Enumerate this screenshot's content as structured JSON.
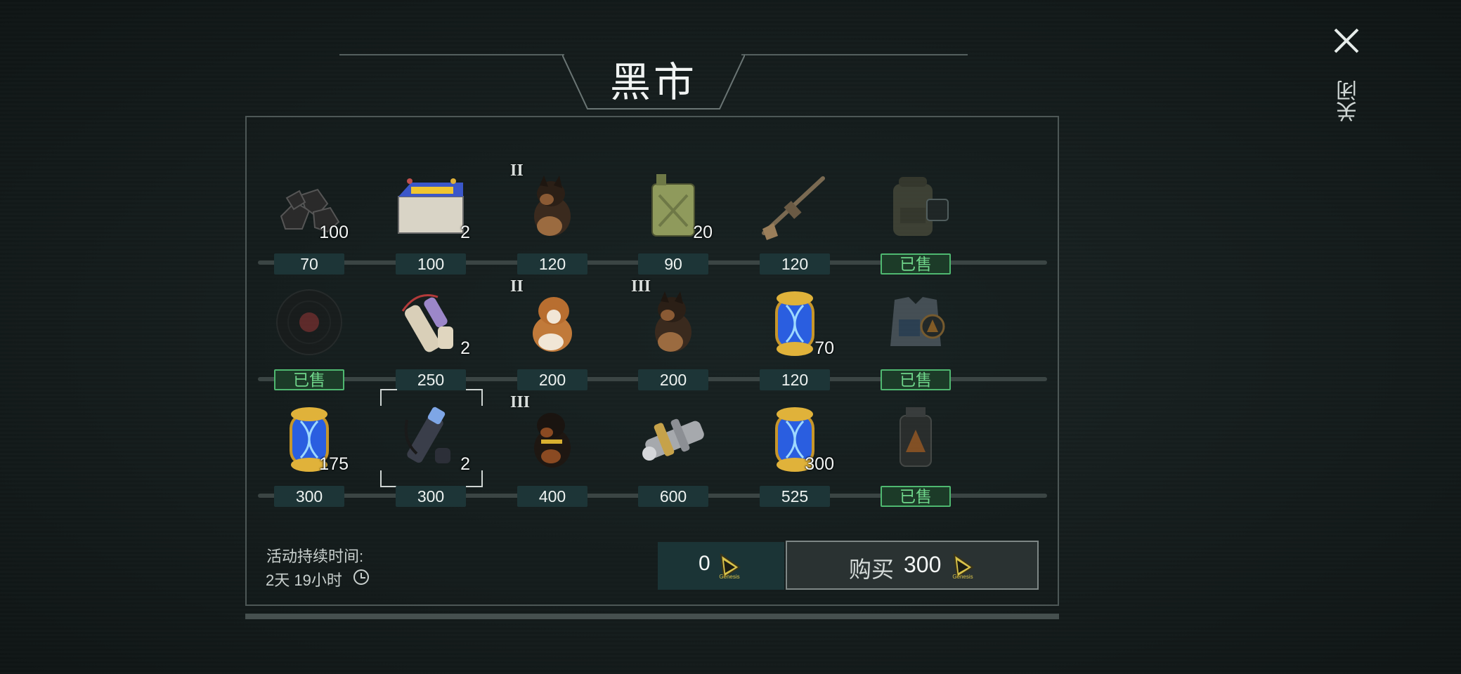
{
  "title": "黑市",
  "close_label": "关闭",
  "items": [
    {
      "icon": "coal-icon",
      "qty": "100",
      "tier": "",
      "price": "70",
      "sold": false
    },
    {
      "icon": "battery-icon",
      "qty": "2",
      "tier": "",
      "price": "100",
      "sold": false
    },
    {
      "icon": "puppy-shepherd-icon",
      "qty": "",
      "tier": "II",
      "price": "120",
      "sold": false
    },
    {
      "icon": "fuel-can-icon",
      "qty": "20",
      "tier": "",
      "price": "90",
      "sold": false
    },
    {
      "icon": "rifle-icon",
      "qty": "",
      "tier": "",
      "price": "120",
      "sold": false
    },
    {
      "icon": "backpack-icon",
      "qty": "",
      "tier": "",
      "price": "已售",
      "sold": true
    },
    {
      "icon": "vinyl-record-icon",
      "qty": "",
      "tier": "",
      "price": "已售",
      "sold": true
    },
    {
      "icon": "scroll-tube-icon",
      "qty": "2",
      "tier": "",
      "price": "250",
      "sold": false
    },
    {
      "icon": "puppy-saint-bernard-icon",
      "qty": "",
      "tier": "II",
      "price": "200",
      "sold": false
    },
    {
      "icon": "puppy-shepherd-icon",
      "qty": "",
      "tier": "III",
      "price": "200",
      "sold": false
    },
    {
      "icon": "dna-capsule-icon",
      "qty": "70",
      "tier": "",
      "price": "120",
      "sold": false
    },
    {
      "icon": "body-armor-icon",
      "qty": "",
      "tier": "",
      "price": "已售",
      "sold": true
    },
    {
      "icon": "dna-capsule-icon",
      "qty": "175",
      "tier": "",
      "price": "300",
      "sold": false
    },
    {
      "icon": "scope-parts-icon",
      "qty": "2",
      "tier": "",
      "price": "300",
      "sold": false,
      "selected": true
    },
    {
      "icon": "puppy-rottweiler-icon",
      "qty": "",
      "tier": "III",
      "price": "400",
      "sold": false
    },
    {
      "icon": "gear-shaft-icon",
      "qty": "",
      "tier": "",
      "price": "600",
      "sold": false
    },
    {
      "icon": "dna-capsule-icon",
      "qty": "300",
      "tier": "",
      "price": "525",
      "sold": false
    },
    {
      "icon": "fire-grenade-icon",
      "qty": "",
      "tier": "",
      "price": "已售",
      "sold": true
    }
  ],
  "footer": {
    "duration_label": "活动持续时间:",
    "duration_value": "2天 19小时",
    "balance": "0",
    "buy_label": "购买",
    "buy_price": "300",
    "currency_icon": "genesis-coin-icon"
  }
}
